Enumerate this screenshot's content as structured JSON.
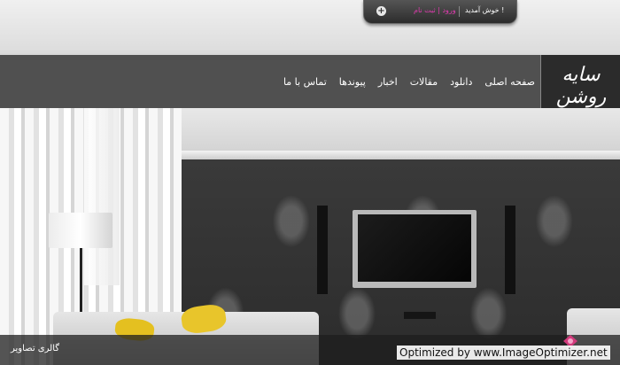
{
  "header": {
    "welcome_text": "خوش آمدید !",
    "login_links": "ورود | ثبت نام",
    "plus_label": "+"
  },
  "logo": {
    "text": "سایه روشن"
  },
  "nav": {
    "items": [
      {
        "label": "صفحه اصلی"
      },
      {
        "label": "دانلود"
      },
      {
        "label": "مقالات"
      },
      {
        "label": "اخبار"
      },
      {
        "label": "پیوندها"
      },
      {
        "label": "تماس با ما"
      }
    ]
  },
  "footer": {
    "gallery_label": "گالری تصاویر",
    "watermark": "Optimized by www.ImageOptimizer.net"
  },
  "colors": {
    "accent_link": "#e23ab0",
    "navbar": "#3c3c3c"
  }
}
